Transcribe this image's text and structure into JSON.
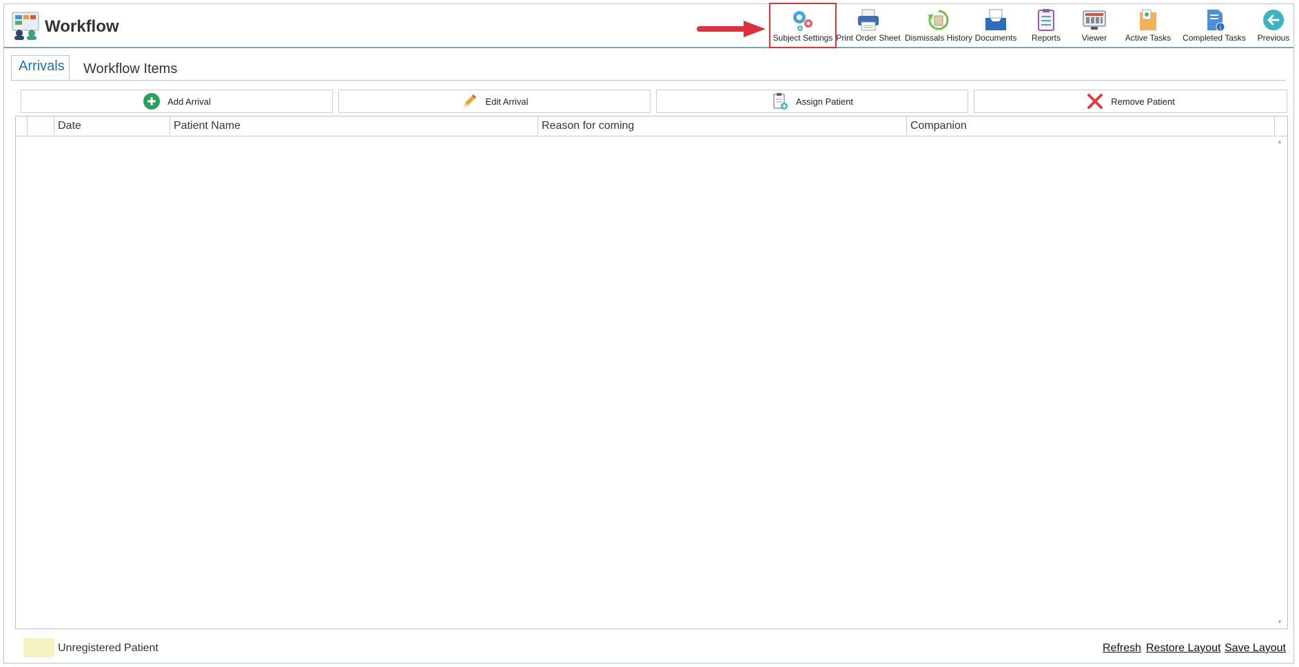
{
  "header": {
    "title": "Workflow",
    "toolbar": [
      {
        "label": "Subject Settings",
        "icon": "gears-icon"
      },
      {
        "label": "Print Order Sheet",
        "icon": "printer-icon"
      },
      {
        "label": "Dismissals History",
        "icon": "history-icon"
      },
      {
        "label": "Documents",
        "icon": "inbox-tray-icon"
      },
      {
        "label": "Reports",
        "icon": "clipboard-icon"
      },
      {
        "label": "Viewer",
        "icon": "monitor-icon"
      },
      {
        "label": "Active Tasks",
        "icon": "task-box-icon"
      },
      {
        "label": "Completed Tasks",
        "icon": "document-check-icon"
      },
      {
        "label": "Previous",
        "icon": "back-arrow-icon"
      }
    ]
  },
  "tabs": [
    {
      "label": "Arrivals",
      "active": true
    },
    {
      "label": "Workflow Items",
      "active": false
    }
  ],
  "actions": [
    {
      "label": "Add Arrival",
      "icon": "plus-circle-icon"
    },
    {
      "label": "Edit Arrival",
      "icon": "pencil-icon"
    },
    {
      "label": "Assign Patient",
      "icon": "clipboard-add-icon"
    },
    {
      "label": "Remove Patient",
      "icon": "x-icon"
    }
  ],
  "grid": {
    "columns": [
      "Date",
      "Patient Name",
      "Reason for coming",
      "Companion"
    ],
    "rows": []
  },
  "footer": {
    "legend_label": "Unregistered Patient",
    "legend_color": "#f7f3c3",
    "links": [
      "Refresh",
      "Restore Layout",
      "Save Layout"
    ]
  },
  "colors": {
    "accent": "#1a73b8",
    "highlight": "#e0313a"
  }
}
